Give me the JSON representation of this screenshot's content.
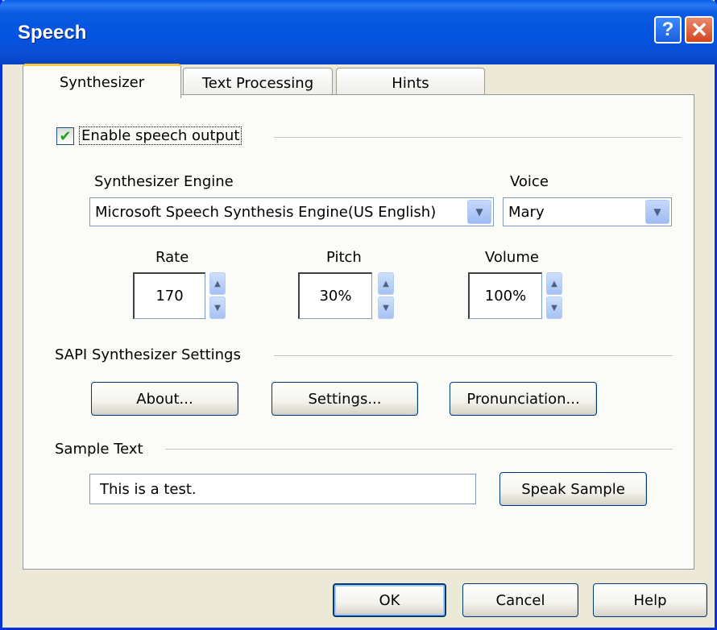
{
  "window": {
    "title": "Speech",
    "help_glyph": "?",
    "close_glyph": "✕"
  },
  "tabs": [
    {
      "label": "Synthesizer",
      "active": true
    },
    {
      "label": "Text Processing",
      "active": false
    },
    {
      "label": "Hints",
      "active": false
    }
  ],
  "synthesizer": {
    "enable_label": "Enable speech output",
    "enable_checked": true,
    "engine_label": "Synthesizer Engine",
    "engine_value": "Microsoft Speech Synthesis Engine(US English)",
    "voice_label": "Voice",
    "voice_value": "Mary",
    "rate_label": "Rate",
    "rate_value": "170",
    "pitch_label": "Pitch",
    "pitch_value": "30%",
    "volume_label": "Volume",
    "volume_value": "100%",
    "sapi_label": "SAPI Synthesizer Settings",
    "about_button": "About...",
    "settings_button": "Settings...",
    "pronunciation_button": "Pronunciation...",
    "sample_label": "Sample Text",
    "sample_value": "This is a test.",
    "speak_button": "Speak Sample"
  },
  "footer": {
    "ok_button": "OK",
    "cancel_button": "Cancel",
    "help_button": "Help"
  },
  "colors": {
    "titlebar": "#0a5ae0",
    "dialog_bg": "#ece9d8",
    "active_tab_accent": "#ffc83c",
    "checkmark": "#21a121"
  },
  "icons": {
    "checkbox": "checkmark-icon",
    "combo": "chevron-down-icon",
    "spin_up": "arrow-up-icon",
    "spin_down": "arrow-down-icon"
  }
}
